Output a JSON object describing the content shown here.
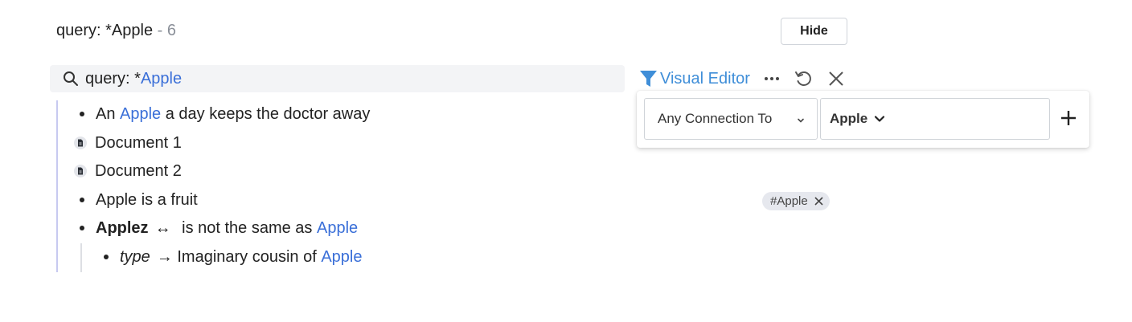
{
  "header": {
    "title": "query: *Apple",
    "separator": " - ",
    "count": "6"
  },
  "hide_label": "Hide",
  "search": {
    "prefix": "query: *",
    "term": "Apple",
    "icon": "search-icon"
  },
  "toolbar": {
    "visual_editor_label": "Visual Editor",
    "icons": [
      "filter-icon",
      "more-icon",
      "refresh-icon",
      "close-icon"
    ]
  },
  "filter": {
    "connection_type": "Any Connection To",
    "target": "Apple",
    "add_icon": "plus-icon"
  },
  "tag": {
    "label": "#Apple"
  },
  "results": {
    "r1": {
      "pre": "An ",
      "link": "Apple",
      "post": " a day keeps the doctor away"
    },
    "r2": {
      "label": "Document 1",
      "icon": "document-icon"
    },
    "r3": {
      "label": "Document 2",
      "icon": "document-icon"
    },
    "r4": {
      "label": "Apple is a fruit"
    },
    "r5": {
      "name": "Applez",
      "rel": "↔",
      "text": " is not the same as ",
      "link": "Apple"
    },
    "r6": {
      "prop": "type",
      "arrow": "→",
      "text": " Imaginary cousin of ",
      "link": "Apple"
    }
  },
  "colors": {
    "link": "#3a6fd8",
    "accent": "#3f8ed8",
    "thread": "#c7c9f0"
  }
}
